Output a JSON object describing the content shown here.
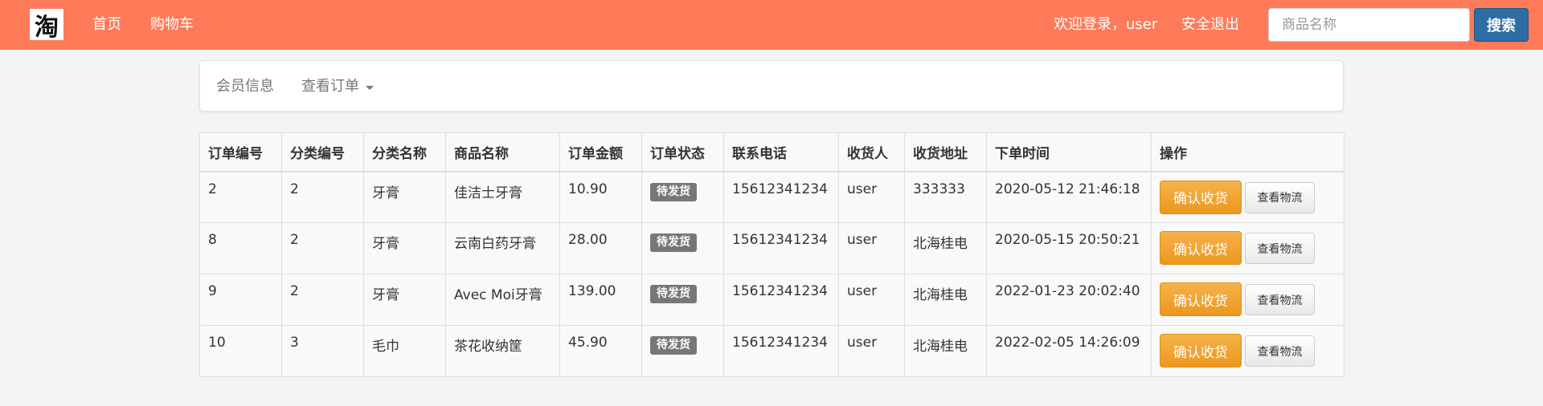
{
  "navbar": {
    "logo_char": "淘",
    "home_label": "首页",
    "cart_label": "购物车",
    "welcome_label": "欢迎登录，user",
    "logout_label": "安全退出",
    "search_placeholder": "商品名称",
    "search_button_label": "搜索",
    "background_color": "#ff7a59",
    "search_button_color": "#2e6da4"
  },
  "member_nav": {
    "member_info_label": "会员信息",
    "view_orders_label": "查看订单"
  },
  "orders_table": {
    "headers": {
      "order_id": "订单编号",
      "category_id": "分类编号",
      "category_name": "分类名称",
      "product_name": "商品名称",
      "amount": "订单金额",
      "status": "订单状态",
      "phone": "联系电话",
      "receiver": "收货人",
      "address": "收货地址",
      "order_time": "下单时间",
      "actions": "操作"
    },
    "rows": [
      {
        "order_id": "2",
        "category_id": "2",
        "category_name": "牙膏",
        "product_name": "佳洁士牙膏",
        "amount": "10.90",
        "status": "待发货",
        "phone": "15612341234",
        "receiver": "user",
        "address": "333333",
        "order_time": "2020-05-12 21:46:18",
        "confirm_label": "确认收货",
        "logistics_label": "查看物流"
      },
      {
        "order_id": "8",
        "category_id": "2",
        "category_name": "牙膏",
        "product_name": "云南白药牙膏",
        "amount": "28.00",
        "status": "待发货",
        "phone": "15612341234",
        "receiver": "user",
        "address": "北海桂电",
        "order_time": "2020-05-15 20:50:21",
        "confirm_label": "确认收货",
        "logistics_label": "查看物流"
      },
      {
        "order_id": "9",
        "category_id": "2",
        "category_name": "牙膏",
        "product_name": "Avec Moi牙膏",
        "amount": "139.00",
        "status": "待发货",
        "phone": "15612341234",
        "receiver": "user",
        "address": "北海桂电",
        "order_time": "2022-01-23 20:02:40",
        "confirm_label": "确认收货",
        "logistics_label": "查看物流"
      },
      {
        "order_id": "10",
        "category_id": "3",
        "category_name": "毛巾",
        "product_name": "茶花收纳筐",
        "amount": "45.90",
        "status": "待发货",
        "phone": "15612341234",
        "receiver": "user",
        "address": "北海桂电",
        "order_time": "2022-02-05 14:26:09",
        "confirm_label": "确认收货",
        "logistics_label": "查看物流"
      }
    ]
  }
}
